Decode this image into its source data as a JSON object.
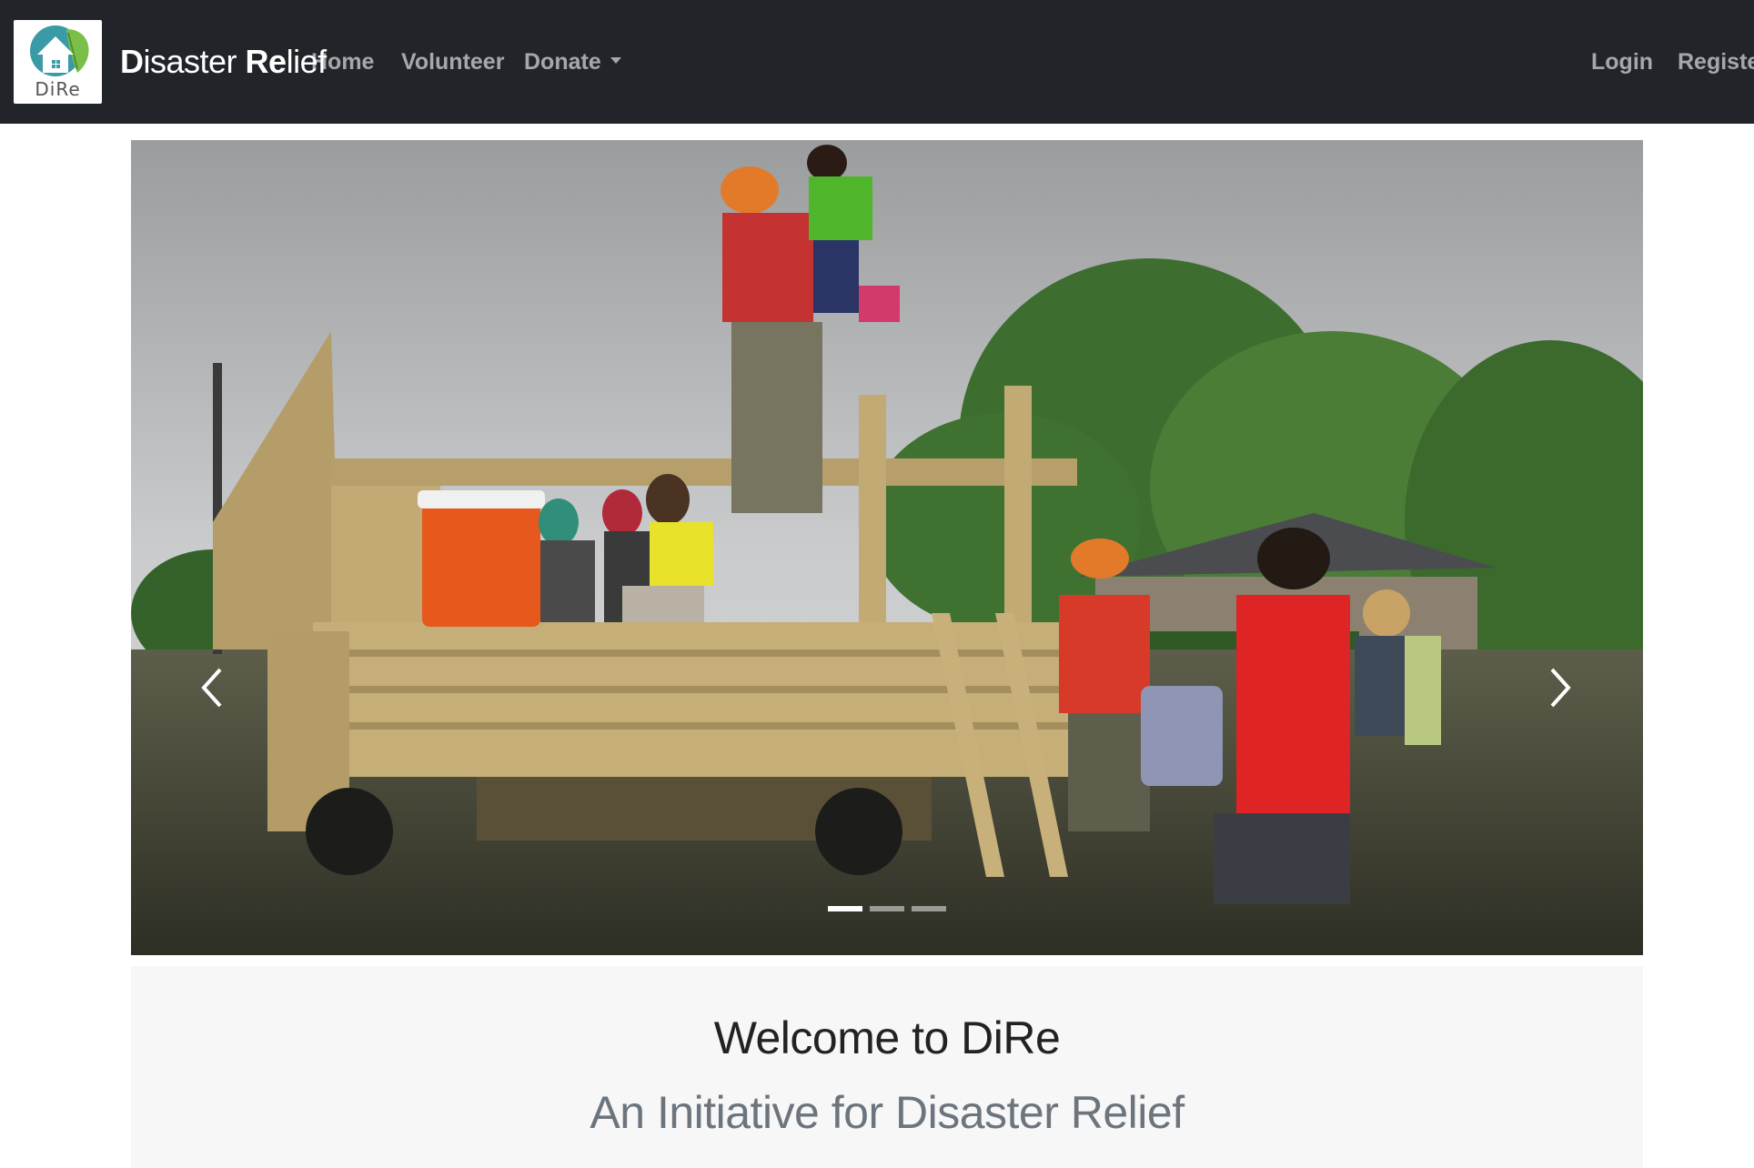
{
  "navbar": {
    "logo_text": "DiRe",
    "brand": {
      "part1": "D",
      "part2": "i",
      "part3": "saster ",
      "part4": "Re",
      "part5": "lief"
    },
    "links": [
      {
        "label": "Home"
      },
      {
        "label": "Volunteer"
      },
      {
        "label": "Donate"
      }
    ],
    "auth": [
      {
        "label": "Login"
      },
      {
        "label": "Register"
      }
    ]
  },
  "carousel": {
    "slide_count": 3,
    "active_index": 0
  },
  "welcome": {
    "title": "Welcome to DiRe",
    "subtitle": "An Initiative for Disaster Relief"
  },
  "colors": {
    "navbar_bg": "#212529",
    "nav_link": "rgba(255,255,255,0.6)",
    "jumbotron_bg": "#f7f7f7"
  }
}
